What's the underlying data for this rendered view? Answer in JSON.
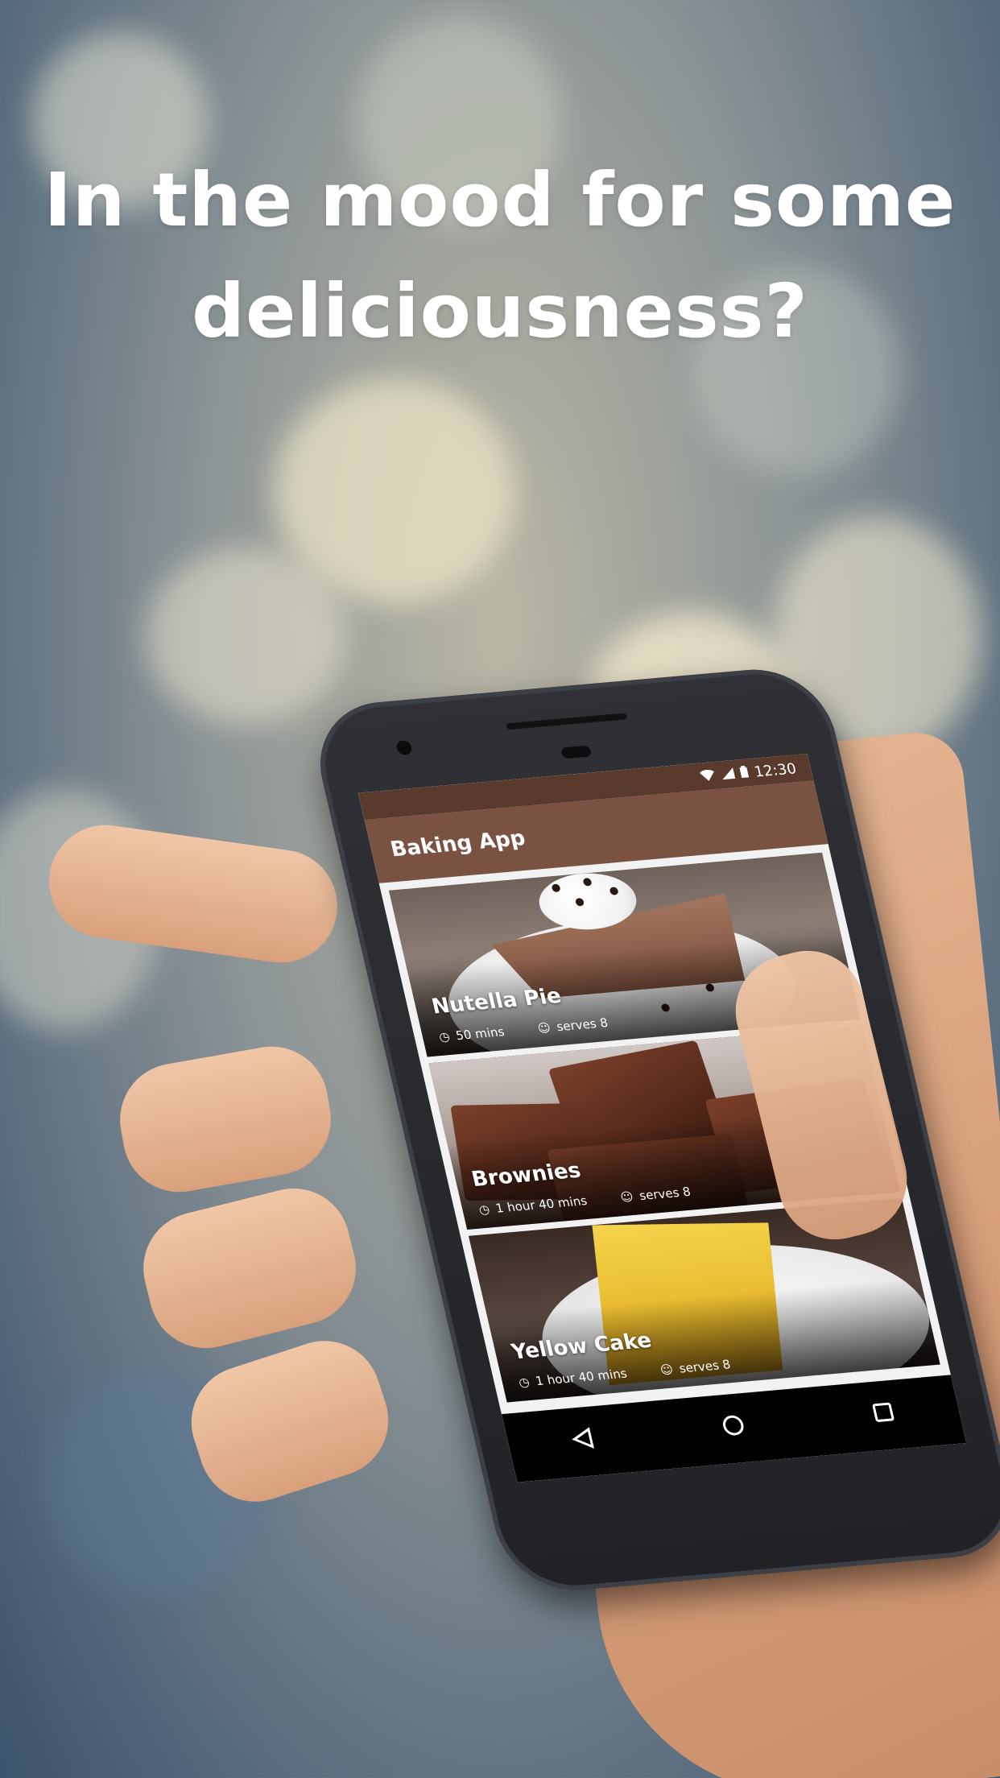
{
  "headline": {
    "line1": "In the mood for some",
    "line2": "deliciousness?"
  },
  "status_bar": {
    "wifi_icon": "wifi-icon",
    "signal_icon": "signal-icon",
    "battery_icon": "battery-icon",
    "time": "12:30"
  },
  "app_bar": {
    "title": "Baking App"
  },
  "recipes": [
    {
      "name": "Nutella Pie",
      "time": "50 mins",
      "servings": "serves 8"
    },
    {
      "name": "Brownies",
      "time": "1 hour 40 mins",
      "servings": "serves 8"
    },
    {
      "name": "Yellow Cake",
      "time": "1 hour 40 mins",
      "servings": "serves 8"
    }
  ],
  "icons": {
    "clock": "clock-icon",
    "serving": "smiley-icon",
    "back": "back-triangle-icon",
    "home": "home-circle-icon",
    "recents": "recents-square-icon"
  },
  "colors": {
    "status_bar": "#5b3a2e",
    "app_bar": "#7a5242",
    "headline_text": "#ffffff"
  }
}
